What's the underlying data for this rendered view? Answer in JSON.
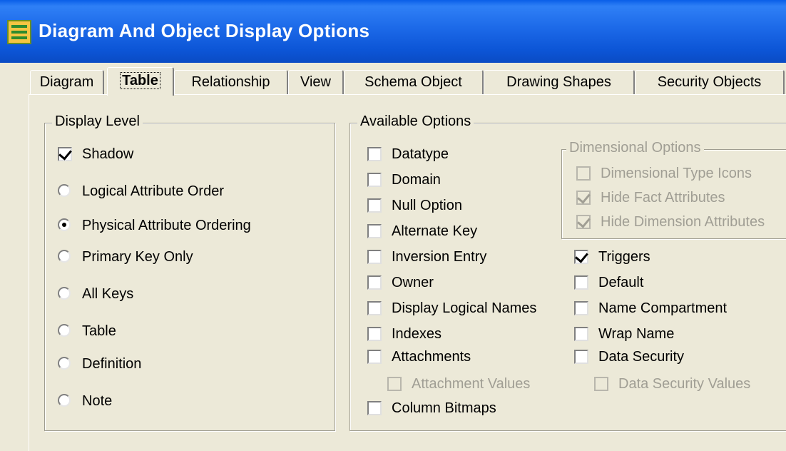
{
  "window": {
    "title": "Diagram And Object Display Options"
  },
  "tabs": [
    {
      "label": "Diagram",
      "active": false
    },
    {
      "label": "Table",
      "active": true
    },
    {
      "label": "Relationship",
      "active": false
    },
    {
      "label": "View",
      "active": false
    },
    {
      "label": "Schema Object",
      "active": false
    },
    {
      "label": "Drawing Shapes",
      "active": false
    },
    {
      "label": "Security Objects",
      "active": false
    }
  ],
  "display_level": {
    "title": "Display Level",
    "shadow": {
      "label": "Shadow",
      "checked": true
    },
    "options": [
      {
        "label": "Logical Attribute Order",
        "selected": false
      },
      {
        "label": "Physical Attribute Ordering",
        "selected": true
      },
      {
        "label": "Primary Key Only",
        "selected": false
      },
      {
        "label": "All Keys",
        "selected": false
      },
      {
        "label": "Table",
        "selected": false
      },
      {
        "label": "Definition",
        "selected": false
      },
      {
        "label": "Note",
        "selected": false
      }
    ]
  },
  "available_options": {
    "title": "Available Options",
    "left": [
      {
        "label": "Datatype",
        "checked": false
      },
      {
        "label": "Domain",
        "checked": false
      },
      {
        "label": "Null Option",
        "checked": false
      },
      {
        "label": "Alternate Key",
        "checked": false
      },
      {
        "label": "Inversion Entry",
        "checked": false
      },
      {
        "label": "Owner",
        "checked": false
      },
      {
        "label": "Display Logical Names",
        "checked": false
      },
      {
        "label": "Indexes",
        "checked": false
      },
      {
        "label": "Attachments",
        "checked": false
      },
      {
        "label": "Attachment Values",
        "checked": false,
        "disabled": true
      },
      {
        "label": "Column Bitmaps",
        "checked": false
      }
    ],
    "dimensional": {
      "title": "Dimensional Options",
      "items": [
        {
          "label": "Dimensional Type Icons",
          "checked": false,
          "disabled": true
        },
        {
          "label": "Hide Fact Attributes",
          "checked": true,
          "disabled": true
        },
        {
          "label": "Hide Dimension Attributes",
          "checked": true,
          "disabled": true
        }
      ]
    },
    "right": [
      {
        "label": "Triggers",
        "checked": true
      },
      {
        "label": "Default",
        "checked": false
      },
      {
        "label": "Name Compartment",
        "checked": false
      },
      {
        "label": "Wrap Name",
        "checked": false
      },
      {
        "label": "Data Security",
        "checked": false
      },
      {
        "label": "Data Security Values",
        "checked": false,
        "disabled": true
      }
    ]
  },
  "colors": {
    "titlebar": "#0A5FE8",
    "face": "#ECE9D8",
    "disabled_text": "#A09E94"
  }
}
